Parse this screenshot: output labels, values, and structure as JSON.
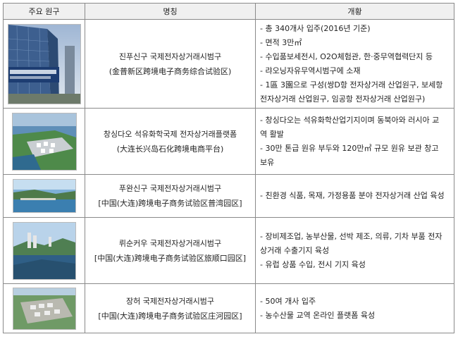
{
  "header": {
    "col1": "주요 원구",
    "col2": "명칭",
    "col3": "개황"
  },
  "rows": [
    {
      "photo": "government-building-photo",
      "name_ko": "진푸신구 국제전자상거래시범구",
      "name_zh": "(金普新区跨境电子商务综合试验区)",
      "desc": [
        [
          "총 340개사 입주(2016년 기준)"
        ],
        [
          "면적 3만㎡"
        ],
        [
          "수입품보세전시, O2O체험관, 한·중무역협력단지 등"
        ],
        [
          "랴오닝자유무역시범구에 소재"
        ],
        [
          "1區 3園으로 구성(쌍D항 전자상거래 산업원구, 보세항",
          "전자상거래 산업원구, 임공항 전자상거래 산업원구)"
        ]
      ]
    },
    {
      "photo": "port-aerial-render",
      "name_ko": "창싱다오 석유화학국제 전자상거래플랫폼",
      "name_zh": "(大连长兴岛石化跨境电商平台)",
      "desc": [
        [
          "창싱다오는 석유화학산업기지이며 동북아와 러시아 교",
          "역 활발"
        ],
        [
          "30만 톤급 원유 부두와 120만㎥ 규모 원유 보관 창고",
          "보유"
        ]
      ]
    },
    {
      "photo": "bay-panorama-photo",
      "name_ko": "푸완신구 국제전자상거래시범구",
      "name_zh": "[中国(大连)跨境电子商务试验区普湾园区]",
      "desc": [
        [
          "친환경 식품, 목재, 가정용품 분야 전자상거래 산업 육성"
        ]
      ]
    },
    {
      "photo": "harbor-city-photo",
      "name_ko": "뤼순커우 국제전자상거래시범구",
      "name_zh": "[中国(大连)跨境电子商务试验区旅顺口园区]",
      "desc": [
        [
          "장비제조업, 농부산물, 선박 제조, 의류, 기차 부품 전자",
          "상거래 수출기지 육성"
        ],
        [
          "유럽 상품 수입, 전시 기지 육성"
        ]
      ]
    },
    {
      "photo": "industrial-park-render",
      "name_ko": "장허 국제전자상거래시범구",
      "name_zh": "[中国(大连)跨境电子商务试验区庄河园区]",
      "desc": [
        [
          "50여 개사 입주"
        ],
        [
          "농수산물 교역 온라인 플랫폼 육성"
        ]
      ]
    }
  ]
}
